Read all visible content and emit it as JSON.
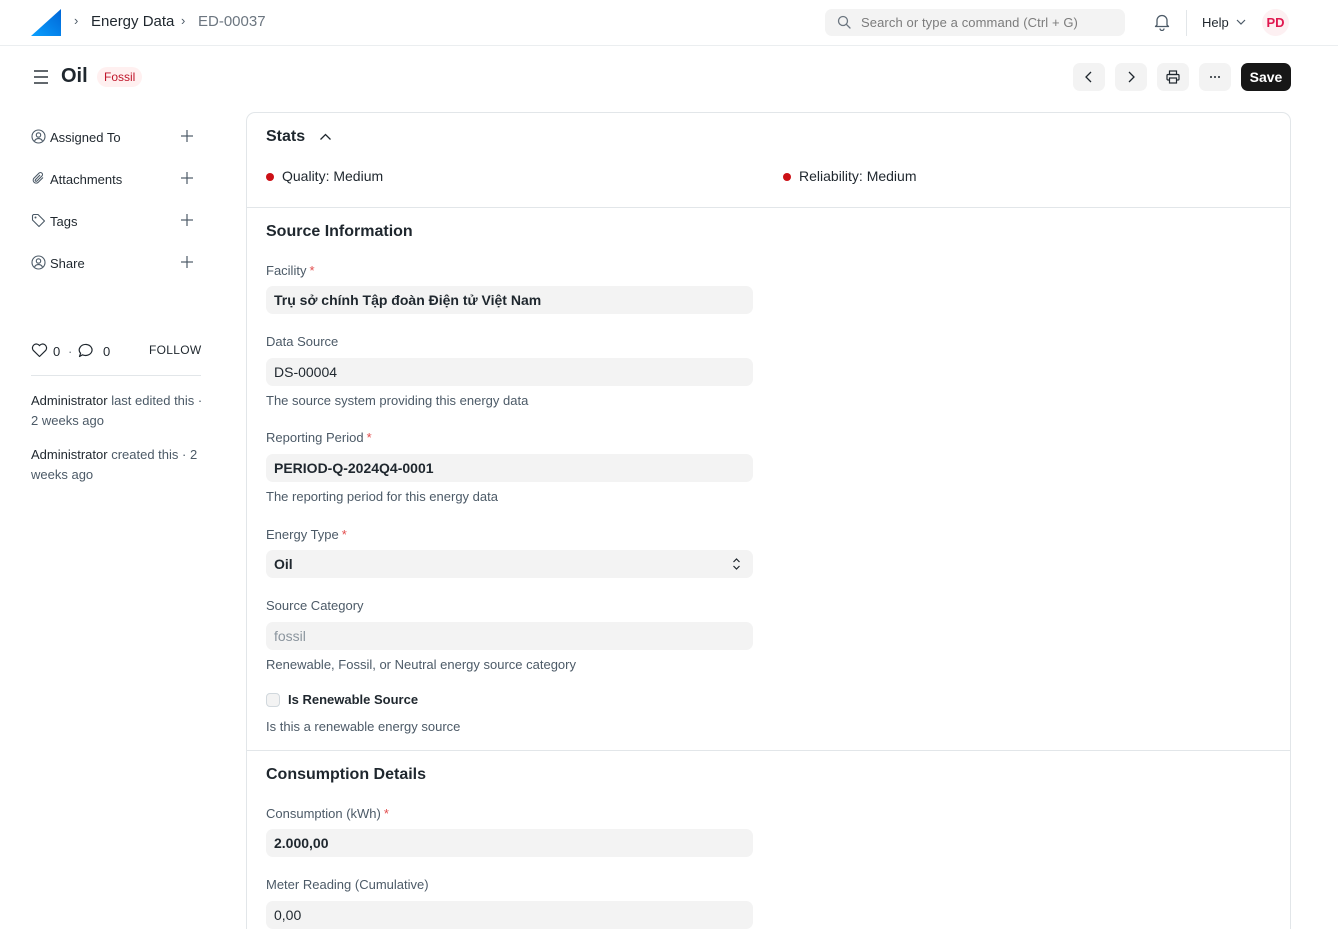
{
  "navbar": {
    "breadcrumbs": [
      "Energy Data",
      "ED-00037"
    ],
    "search_placeholder": "Search or type a command (Ctrl + G)",
    "help_label": "Help",
    "avatar_initials": "PD"
  },
  "page": {
    "title": "Oil",
    "status_badge": "Fossil",
    "save_label": "Save"
  },
  "sidebar": {
    "items": [
      {
        "label": "Assigned To",
        "icon": "user-assign-icon"
      },
      {
        "label": "Attachments",
        "icon": "paperclip-icon"
      },
      {
        "label": "Tags",
        "icon": "tag-icon"
      },
      {
        "label": "Share",
        "icon": "user-share-icon"
      }
    ],
    "likes": "0",
    "comments": "0",
    "follow_label": "FOLLOW",
    "activity": [
      {
        "user": "Administrator",
        "text": " last edited this · 2 weeks ago"
      },
      {
        "user": "Administrator",
        "text": " created this · 2 weeks ago"
      }
    ]
  },
  "stats": {
    "title": "Stats",
    "quality": "Quality: Medium",
    "reliability": "Reliability: Medium",
    "indicator_color": "#cc1016"
  },
  "source_info": {
    "title": "Source Information",
    "facility_label": "Facility",
    "facility_value": "Trụ sở chính Tập đoàn Điện tử Việt Nam",
    "data_source_label": "Data Source",
    "data_source_value": "DS-00004",
    "data_source_desc": "The source system providing this energy data",
    "reporting_period_label": "Reporting Period",
    "reporting_period_value": "PERIOD-Q-2024Q4-0001",
    "reporting_period_desc": "The reporting period for this energy data",
    "energy_type_label": "Energy Type",
    "energy_type_value": "Oil",
    "source_category_label": "Source Category",
    "source_category_value": "fossil",
    "source_category_desc": "Renewable, Fossil, or Neutral energy source category",
    "is_renewable_label": "Is Renewable Source",
    "is_renewable_checked": false,
    "is_renewable_desc": "Is this a renewable energy source"
  },
  "consumption": {
    "title": "Consumption Details",
    "consumption_label": "Consumption (kWh)",
    "consumption_value": "2.000,00",
    "meter_label": "Meter Reading (Cumulative)",
    "meter_value": "0,00"
  },
  "colors": {
    "accent_logo": "#0089ff",
    "save_button": "#171717",
    "badge_bg": "#fff0f0",
    "badge_text": "#c0162b"
  }
}
